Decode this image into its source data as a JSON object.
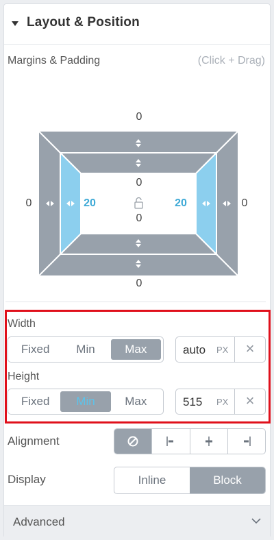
{
  "section": {
    "title": "Layout & Position"
  },
  "margins": {
    "label": "Margins & Padding",
    "hint": "(Click + Drag)",
    "margin_top": "0",
    "margin_bottom": "0",
    "margin_left": "0",
    "margin_right": "0",
    "padding_top": "0",
    "padding_bottom": "0",
    "padding_left": "20",
    "padding_right": "20"
  },
  "width": {
    "label": "Width",
    "options": [
      "Fixed",
      "Min",
      "Max"
    ],
    "selected": "Max",
    "value": "auto",
    "unit": "PX",
    "clear": "×"
  },
  "height": {
    "label": "Height",
    "options": [
      "Fixed",
      "Min",
      "Max"
    ],
    "selected": "Min",
    "value": "515",
    "unit": "PX",
    "clear": "×"
  },
  "alignment": {
    "label": "Alignment",
    "icons": [
      "none-icon",
      "align-left-icon",
      "align-center-icon",
      "align-right-icon"
    ]
  },
  "display": {
    "label": "Display",
    "options": [
      "Inline",
      "Block"
    ],
    "selected": "Block"
  },
  "advanced": {
    "label": "Advanced"
  },
  "colors": {
    "accent_blue": "#3da9d6",
    "active_gray": "#98a1ab",
    "highlight_red": "#e0101b",
    "padding_fill": "#8ccfee"
  }
}
